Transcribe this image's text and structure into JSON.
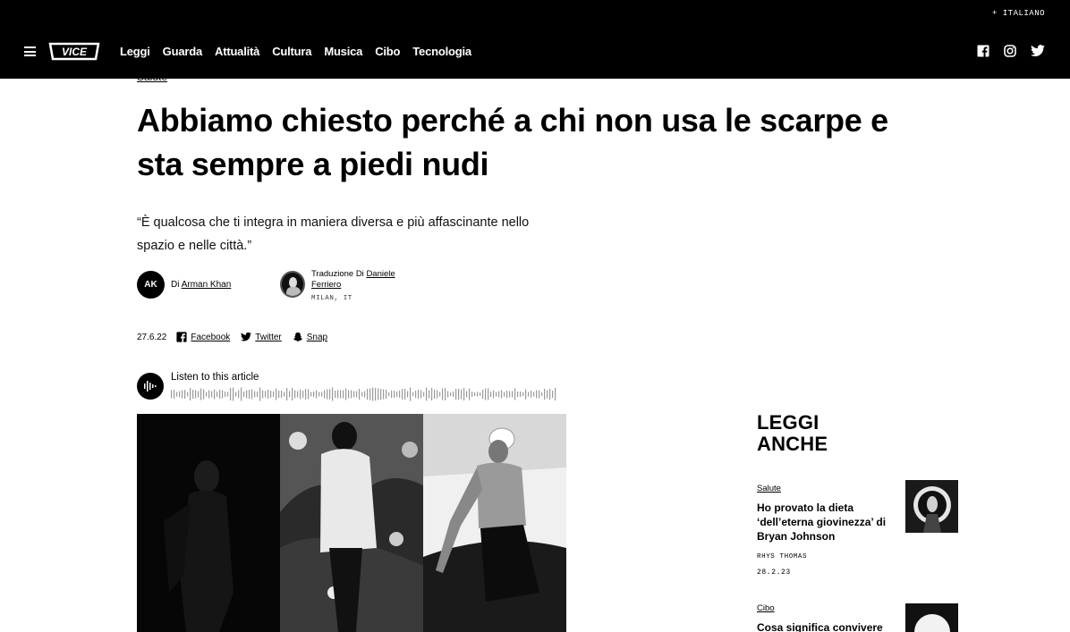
{
  "header": {
    "language": "+ ITALIANO",
    "logo_text": "VICE",
    "nav": [
      "Leggi",
      "Guarda",
      "Attualità",
      "Cultura",
      "Musica",
      "Cibo",
      "Tecnologia"
    ],
    "social_icons": [
      "facebook-icon",
      "instagram-icon",
      "twitter-icon"
    ]
  },
  "article": {
    "category": "Salute",
    "title": "Abbiamo chiesto perché a chi non usa le scarpe e sta sempre a piedi nudi",
    "dek": "“È qualcosa che ti integra in maniera diversa e più affascinante nello spazio e nelle città.”",
    "author": {
      "initials": "AK",
      "prefix": "Di",
      "name": "Arman Khan"
    },
    "translator": {
      "prefix": "Traduzione Di",
      "name": "Daniele Ferriero",
      "location": "MILAN, IT"
    },
    "date": "27.6.22",
    "share": [
      "Facebook",
      "Twitter",
      "Snap"
    ],
    "audio_label": "Listen to this article"
  },
  "related": {
    "heading_line1": "LEGGI",
    "heading_line2": "ANCHE",
    "items": [
      {
        "category": "Salute",
        "title": "Ho provato la dieta ‘dell’eterna giovinezza’ di Bryan Johnson",
        "author": "RHYS THOMAS",
        "date": "28.2.23"
      },
      {
        "category": "Cibo",
        "title": "Cosa significa convivere"
      }
    ]
  },
  "colors": {
    "background": "#ffffff",
    "header": "#000000",
    "text": "#000000"
  }
}
